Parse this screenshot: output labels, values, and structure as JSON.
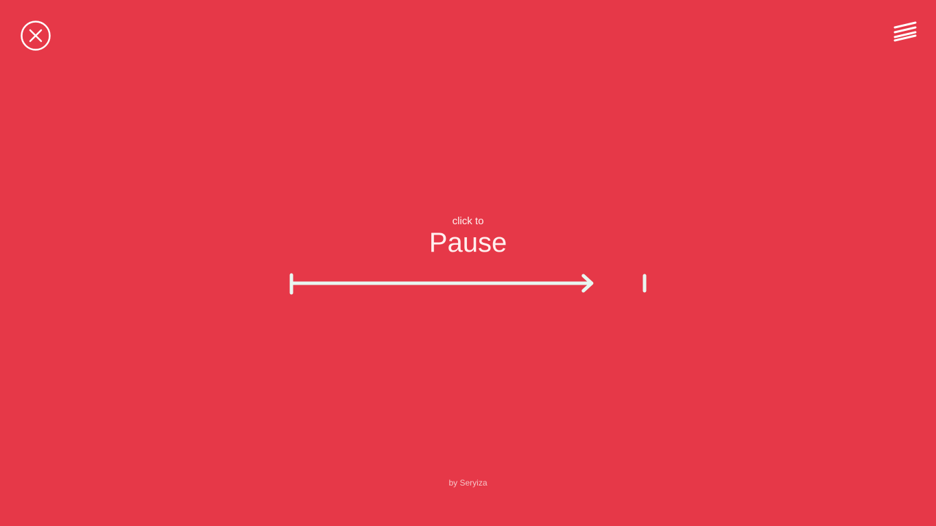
{
  "controls": {
    "close_icon": "close-circle-icon",
    "menu_icon": "menu-lines-icon"
  },
  "main": {
    "caption": "click to",
    "action": "Pause",
    "progress": 0.85
  },
  "footer": {
    "credit": "by Seryiza"
  },
  "colors": {
    "background": "#e63848",
    "foreground": "#e8f6f0",
    "text": "#fff0ef"
  }
}
